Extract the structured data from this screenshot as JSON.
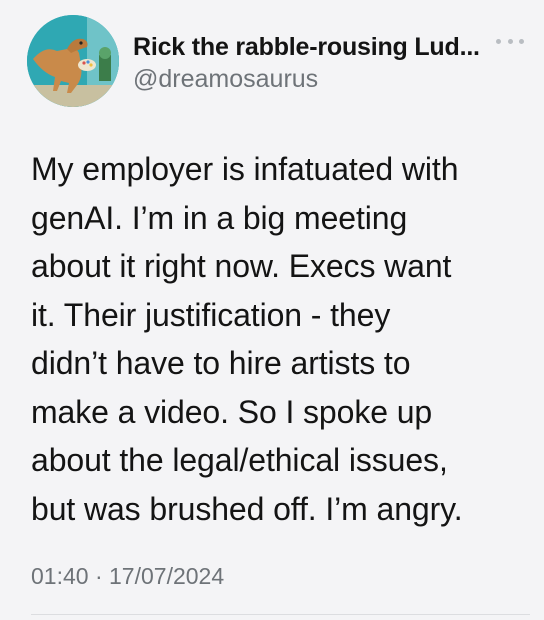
{
  "tweet": {
    "author": {
      "display_name": "Rick the rabble-rousing Lud...",
      "handle": "@dreamosaurus",
      "avatar_icon": "dinosaur-artist-avatar"
    },
    "more_icon": "more-options-icon",
    "text": "My employer is infatuated with\ngenAI. I’m in a big meeting\nabout it right now. Execs want\nit. Their justification - they\ndidn’t have to hire artists to\nmake a video. So I spoke up\nabout the legal/ethical issues,\nbut was brushed off. I’m angry.",
    "time": "01:40",
    "separator": "·",
    "date": "17/07/2024"
  },
  "colors": {
    "background": "#f4f4f6",
    "text": "#141414",
    "muted": "#6e7378",
    "avatar_bg": "#2fa8b3"
  }
}
